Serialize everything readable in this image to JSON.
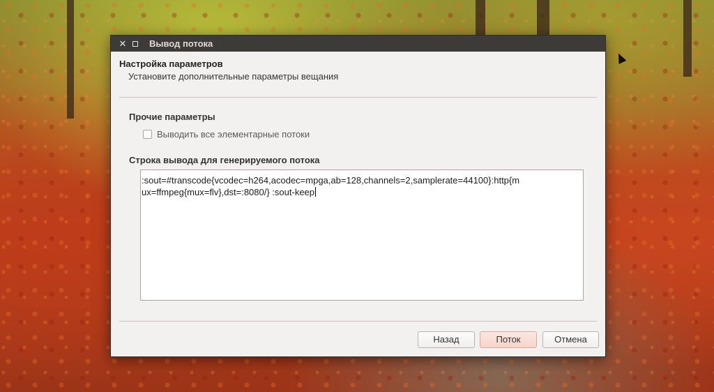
{
  "window": {
    "title": "Вывод потока",
    "close_symbol": "✕"
  },
  "header": {
    "title": "Настройка параметров",
    "subtitle": "Установите дополнительные параметры вещания"
  },
  "other_params": {
    "title": "Прочие параметры",
    "checkbox_label": "Выводить все элементарные потоки",
    "checked": false
  },
  "output_string": {
    "title": "Строка вывода для генерируемого потока",
    "line1": ":sout=#transcode{vcodec=h264,acodec=mpga,ab=128,channels=2,samplerate=44100}:http{m",
    "line2": "ux=ffmpeg{mux=flv},dst=:8080/} :sout-keep"
  },
  "buttons": {
    "back": "Назад",
    "stream": "Поток",
    "cancel": "Отмена"
  },
  "colors": {
    "titlebar": "#3c3b37",
    "dialog_bg": "#f2f1f0",
    "primary_button": "#f6d4cc"
  }
}
